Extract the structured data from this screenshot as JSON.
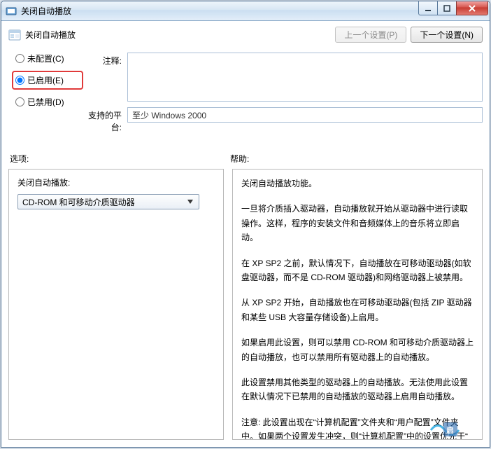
{
  "window": {
    "title": "关闭自动播放",
    "buttons": {
      "minimize": "minimize",
      "maximize": "maximize",
      "close": "close"
    }
  },
  "header": {
    "title": "关闭自动播放",
    "prev": "上一个设置(P)",
    "next": "下一个设置(N)"
  },
  "radio": {
    "not_configured": "未配置(C)",
    "enabled": "已启用(E)",
    "disabled": "已禁用(D)",
    "selected": "enabled"
  },
  "fields": {
    "comment_label": "注释:",
    "comment_value": "",
    "platform_label": "支持的平台:",
    "platform_value": "至少 Windows 2000"
  },
  "sections": {
    "options_label": "选项:",
    "help_label": "帮助:"
  },
  "options": {
    "label": "关闭自动播放:",
    "dropdown_value": "CD-ROM 和可移动介质驱动器"
  },
  "help": {
    "p1": "关闭自动播放功能。",
    "p2": "一旦将介质插入驱动器，自动播放就开始从驱动器中进行读取操作。这样，程序的安装文件和音频媒体上的音乐将立即启动。",
    "p3": "在 XP SP2 之前，默认情况下，自动播放在可移动驱动器(如软盘驱动器，而不是 CD-ROM 驱动器)和网络驱动器上被禁用。",
    "p4": "从 XP SP2 开始，自动播放也在可移动驱动器(包括 ZIP 驱动器和某些 USB 大容量存储设备)上启用。",
    "p5": "如果启用此设置，则可以禁用 CD-ROM 和可移动介质驱动器上的自动播放，也可以禁用所有驱动器上的自动播放。",
    "p6": "此设置禁用其他类型的驱动器上的自动播放。无法使用此设置在默认情况下已禁用的自动播放的驱动器上启用自动播放。",
    "p7": "注意: 此设置出现在“计算机配置”文件夹和“用户配置”文件夹中。如果两个设置发生冲突，则“计算机配置”中的设置优先于“"
  }
}
